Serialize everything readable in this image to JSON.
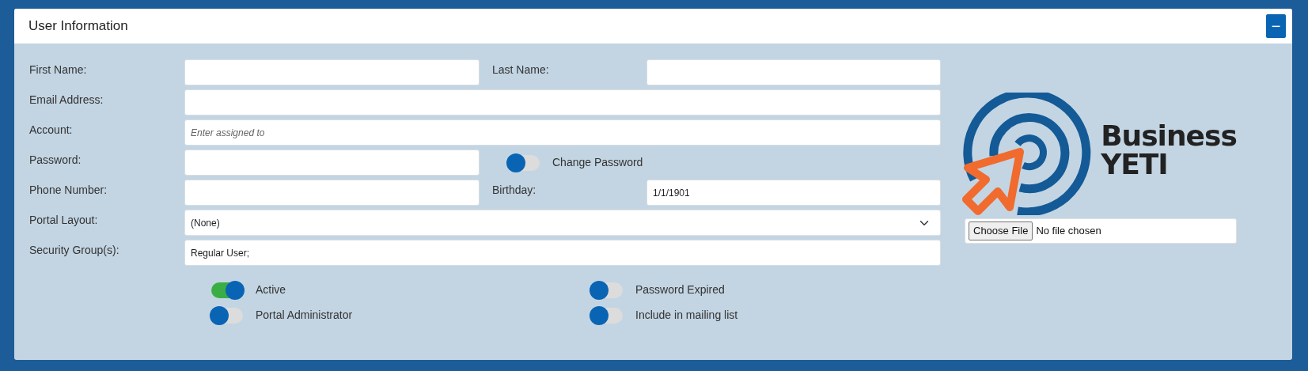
{
  "panel": {
    "title": "User Information",
    "collapse_button": "−"
  },
  "rows": [
    {
      "cells": [
        {
          "label": "First Name:",
          "kind": "text"
        },
        {
          "label": "Last Name:",
          "kind": "text"
        }
      ]
    },
    {
      "cells": [
        {
          "label": "Email Address:",
          "kind": "text"
        }
      ]
    },
    {
      "cells": [
        {
          "label": "Account:",
          "kind": "text",
          "placeholder": "Enter assigned to"
        }
      ]
    },
    {
      "cells": [
        {
          "label": "Password:",
          "kind": "text"
        },
        {
          "label": "Change Password",
          "kind": "toggle",
          "on": false
        }
      ]
    },
    {
      "cells": [
        {
          "label": "Phone Number:",
          "kind": "text"
        },
        {
          "label": "Birthday:",
          "kind": "text",
          "value": "1/1/1901"
        }
      ]
    },
    {
      "cells": [
        {
          "label": "Portal Layout:",
          "kind": "select",
          "value": "(None)"
        }
      ]
    },
    {
      "cells": [
        {
          "label": "Security Group(s):",
          "kind": "text",
          "value": "Regular User;"
        }
      ]
    }
  ],
  "switches": [
    {
      "label": "Active",
      "on": true
    },
    {
      "label": "Password Expired",
      "on": false
    },
    {
      "label": "Portal Administrator",
      "on": false
    },
    {
      "label": "Include in mailing list",
      "on": false
    }
  ],
  "logo": {
    "line_1": "Business",
    "line_2": "YETI"
  },
  "file_input": {
    "button": "Choose File",
    "status": "No file chosen"
  }
}
